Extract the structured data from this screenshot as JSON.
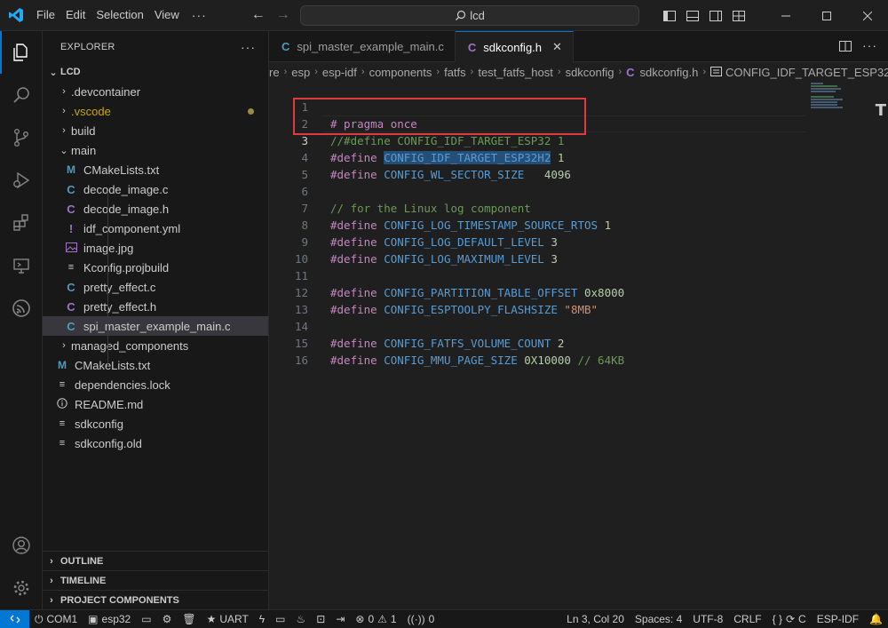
{
  "menu": [
    "File",
    "Edit",
    "Selection",
    "View",
    "···"
  ],
  "search": {
    "text": "lcd"
  },
  "explorer": {
    "header": "EXPLORER",
    "more": "···",
    "root": "LCD",
    "items": [
      {
        "label": ".devcontainer",
        "type": "folder"
      },
      {
        "label": ".vscode",
        "type": "folder",
        "modified": true
      },
      {
        "label": "build",
        "type": "folder"
      },
      {
        "label": "main",
        "type": "folder-open"
      },
      {
        "label": "CMakeLists.txt",
        "icon": "M"
      },
      {
        "label": "decode_image.c",
        "icon": "C"
      },
      {
        "label": "decode_image.h",
        "icon": "C"
      },
      {
        "label": "idf_component.yml",
        "icon": "!"
      },
      {
        "label": "image.jpg",
        "icon": "img"
      },
      {
        "label": "Kconfig.projbuild",
        "icon": "lines"
      },
      {
        "label": "pretty_effect.c",
        "icon": "C"
      },
      {
        "label": "pretty_effect.h",
        "icon": "C"
      },
      {
        "label": "spi_master_example_main.c",
        "icon": "C"
      },
      {
        "label": "managed_components",
        "type": "folder"
      },
      {
        "label": "CMakeLists.txt",
        "icon": "M"
      },
      {
        "label": "dependencies.lock",
        "icon": "lines"
      },
      {
        "label": "README.md",
        "icon": "info"
      },
      {
        "label": "sdkconfig",
        "icon": "lines"
      },
      {
        "label": "sdkconfig.old",
        "icon": "lines"
      }
    ],
    "sections": [
      "OUTLINE",
      "TIMELINE",
      "PROJECT COMPONENTS"
    ]
  },
  "tabs": [
    {
      "label": "spi_master_example_main.c",
      "icon": "C"
    },
    {
      "label": "sdkconfig.h",
      "icon": "C",
      "close": "✕"
    }
  ],
  "breadcrumbs": [
    "re",
    "esp",
    "esp-idf",
    "components",
    "fatfs",
    "test_fatfs_host",
    "sdkconfig",
    "sdkconfig.h",
    "CONFIG_IDF_TARGET_ESP32"
  ],
  "code": {
    "l1": "# pragma once",
    "l2": "//#define CONFIG_IDF_TARGET_ESP32 1",
    "l3_kw": "#define",
    "l3_sel": "CONFIG_IDF_TARGET_ESP32H2",
    "l3_val": "1",
    "l4_kw": "#define",
    "l4_mac": "CONFIG_WL_SECTOR_SIZE",
    "l4_val": "4096",
    "l6": "// for the Linux log component",
    "l7_kw": "#define",
    "l7_mac": "CONFIG_LOG_TIMESTAMP_SOURCE_RTOS",
    "l7_val": "1",
    "l8_kw": "#define",
    "l8_mac": "CONFIG_LOG_DEFAULT_LEVEL",
    "l8_val": "3",
    "l9_kw": "#define",
    "l9_mac": "CONFIG_LOG_MAXIMUM_LEVEL",
    "l9_val": "3",
    "l11_kw": "#define",
    "l11_mac": "CONFIG_PARTITION_TABLE_OFFSET",
    "l11_val": "0x8000",
    "l12_kw": "#define",
    "l12_mac": "CONFIG_ESPTOOLPY_FLASHSIZE",
    "l12_val": "\"8MB\"",
    "l14_kw": "#define",
    "l14_mac": "CONFIG_FATFS_VOLUME_COUNT",
    "l14_val": "2",
    "l15_kw": "#define",
    "l15_mac": "CONFIG_MMU_PAGE_SIZE",
    "l15_val": "0X10000",
    "l15_cmt": "// 64KB",
    "line_numbers": [
      "1",
      "2",
      "3",
      "4",
      "5",
      "6",
      "7",
      "8",
      "9",
      "10",
      "11",
      "12",
      "13",
      "14",
      "15",
      "16"
    ]
  },
  "status": {
    "port": "COM1",
    "target": "esp32",
    "flash": "UART",
    "errors": "0",
    "warnings": "1",
    "ports": "0",
    "position": "Ln 3, Col 20",
    "spaces": "Spaces: 4",
    "encoding": "UTF-8",
    "eol": "CRLF",
    "language": "C",
    "braces": "{ }",
    "framework": "ESP-IDF"
  },
  "colors": {
    "accent": "#0078d4",
    "highlight_box": "#e0393e",
    "selection": "#264f78"
  }
}
